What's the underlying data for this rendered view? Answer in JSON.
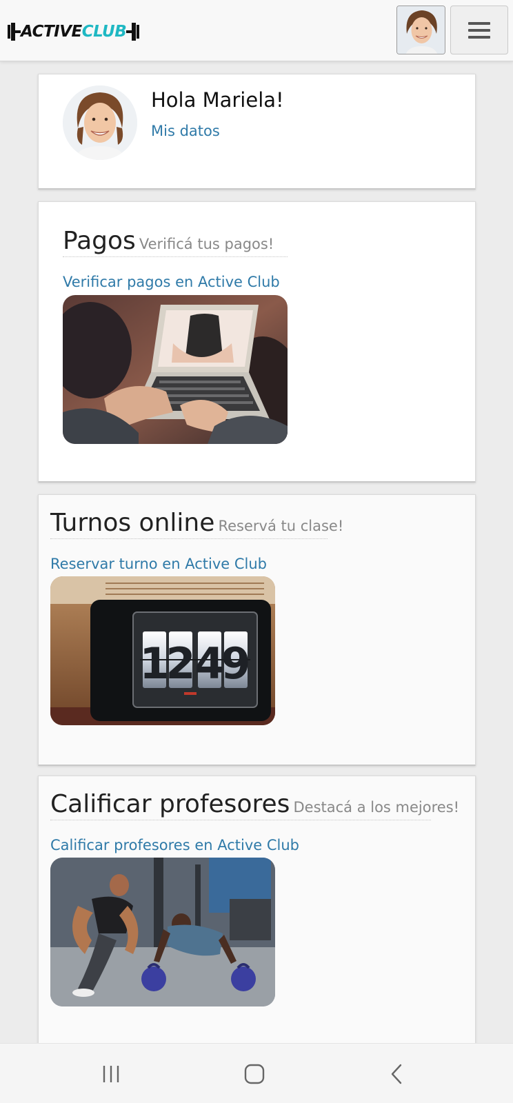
{
  "header": {
    "brand": {
      "part1": "ACTIVE",
      "part2": "CLUB"
    }
  },
  "greeting": {
    "title": "Hola Mariela!",
    "link": "Mis datos"
  },
  "sections": [
    {
      "title": "Pagos",
      "subtitle": "Verificá tus pagos!",
      "link": "Verificar pagos en Active Club",
      "image_subject": "laptop-payment-photo"
    },
    {
      "title": "Turnos online",
      "subtitle": "Reservá tu clase!",
      "link": "Reservar turno en Active Club",
      "image_subject": "flip-clock-photo",
      "clock_digits": [
        "1",
        "2",
        "4",
        "9"
      ]
    },
    {
      "title": "Calificar profesores",
      "subtitle": "Destacá a los mejores!",
      "link": "Calificar profesores en Active Club",
      "image_subject": "trainer-kettlebell-photo"
    }
  ],
  "colors": {
    "brand_accent": "#1fb8c3",
    "link": "#2f7aa8",
    "background": "#ececec"
  }
}
